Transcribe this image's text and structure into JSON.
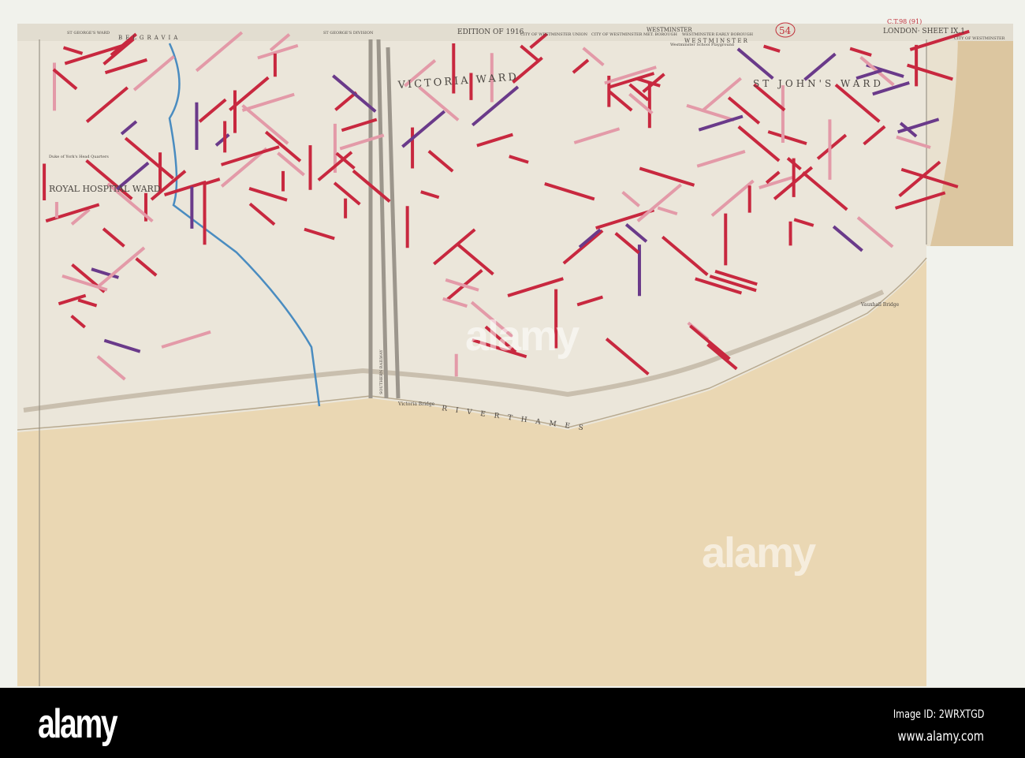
{
  "map": {
    "edition": "EDITION OF 1916",
    "borough": "WESTMINSTER",
    "sheet": "LONDON· SHEET IX.1",
    "sheet_number": "54",
    "catalogue_mark": "C.T.98 (91)",
    "header_labels": [
      "ST GEORGE'S WARD",
      "BELGRAVIA",
      "ST GEORGE'S DIVISION",
      "CITY OF WESTMINSTER UNION",
      "CITY OF WESTMINSTER MET. BOROUGH",
      "WESTMINSTER EARLY BOROUGH",
      "W E S T M I N S T E R",
      "CITY OF WESTMINSTER"
    ],
    "wards": {
      "royal_hospital": "ROYAL HOSPITAL WARD",
      "victoria": "VICTORIA WARD",
      "st_johns": "ST JOHN'S WARD"
    },
    "places": {
      "duke_of_york": "Duke of York's Head Quarters",
      "school": "Westminster School Playground",
      "victoria_bridge": "Victoria Bridge",
      "vauxhall_bridge": "Vauxhall Bridge",
      "river": "R I V E R   T H A M E S",
      "railway": "SOUTHERN RAILWAY"
    },
    "colors": {
      "red": "#c8283f",
      "pink": "#e39aa8",
      "purple": "#6a3a8a",
      "blue": "#4a8cc0",
      "paper": "#ebe6da",
      "tan": "#ead7b3"
    }
  },
  "watermark": {
    "text": "alamy"
  },
  "footer": {
    "logo": "alamy",
    "image_id": "Image ID: 2WRXTGD",
    "site": "www.alamy.com"
  }
}
